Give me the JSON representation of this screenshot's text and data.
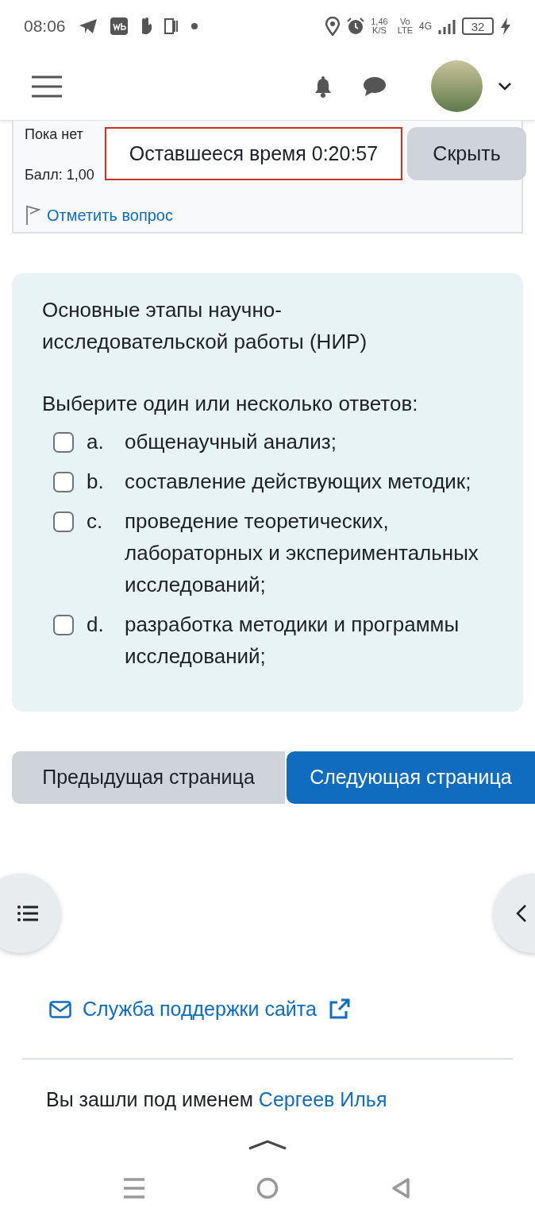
{
  "status_bar": {
    "time": "08:06",
    "speed_value": "1,46",
    "speed_unit": "K/S",
    "volte_top": "Vo",
    "volte_bottom": "LTE",
    "network": "4G",
    "battery": "32"
  },
  "quiz_info": {
    "status_text": "Пока нет",
    "grade": "Балл: 1,00",
    "flag_link": "Отметить вопрос"
  },
  "timer": {
    "label": "Оставшееся время 0:20:57",
    "hide_button": "Скрыть"
  },
  "question": {
    "text": "Основные этапы научно-исследовательской работы (НИР)",
    "prompt": "Выберите один или несколько ответов:",
    "options": [
      {
        "letter": "a.",
        "text": "общенаучный анализ;",
        "checked": false
      },
      {
        "letter": "b.",
        "text": "составление действующих методик;",
        "checked": false
      },
      {
        "letter": "c.",
        "text": "проведение теоретических, лабораторных и экспериментальных исследований;",
        "checked": false
      },
      {
        "letter": "d.",
        "text": "разработка методики и программы исследований;",
        "checked": false
      }
    ]
  },
  "navigation": {
    "previous": "Предыдущая страница",
    "next": "Следующая страница"
  },
  "footer": {
    "support_link": "Служба поддержки сайта",
    "login_prefix": "Вы зашли под именем",
    "user_link": "Сергеев Илья"
  }
}
